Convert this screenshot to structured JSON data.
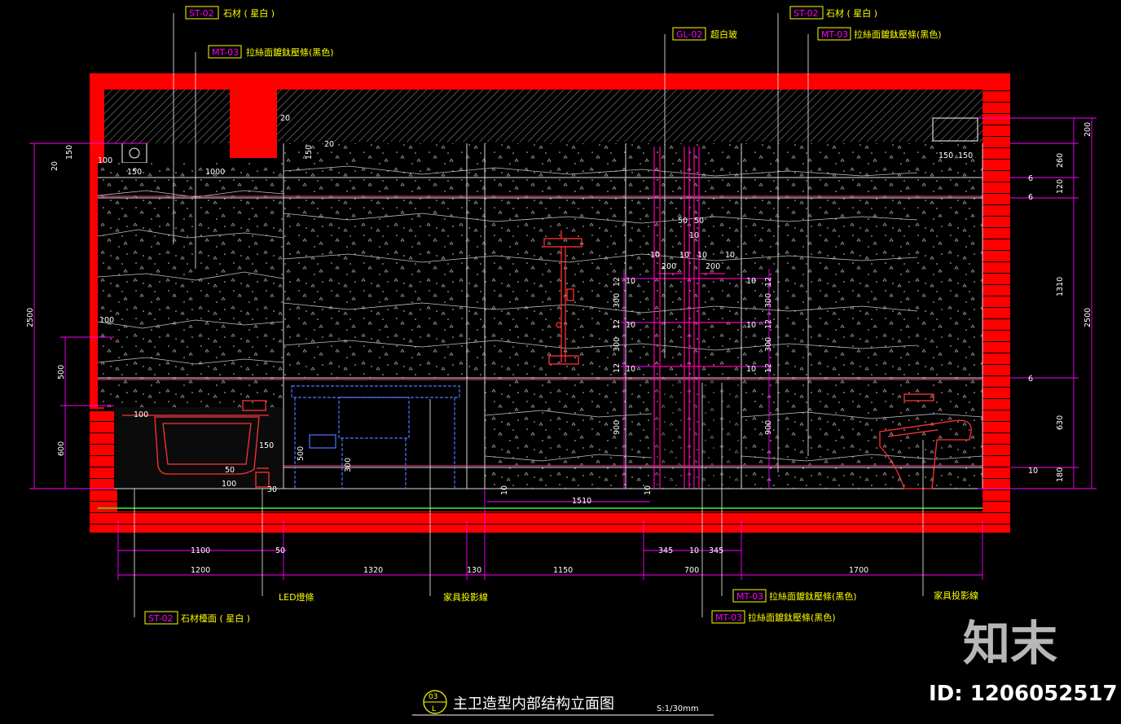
{
  "title": {
    "view_no": "03",
    "sheet_ref": "L",
    "text": "主卫造型内部结构立面图",
    "scale": "S:1/30mm"
  },
  "tags": {
    "top_left_1": {
      "code": "ST-02",
      "text": "石材 ( 星白 )"
    },
    "top_left_2": {
      "code": "MT-03",
      "text": "拉絲面鍍鈦壓條(黑色)"
    },
    "top_mid": {
      "code": "GL-02",
      "text": "超白玻"
    },
    "top_right_1": {
      "code": "ST-02",
      "text": "石材 ( 星白 )"
    },
    "top_right_2": {
      "code": "MT-03",
      "text": "拉絲面鍍鈦壓條(黑色)"
    },
    "bottom_led": {
      "code": "",
      "text": "LED燈條"
    },
    "bottom_furn_1": {
      "code": "",
      "text": "家具投影線"
    },
    "bottom_stone": {
      "code": "ST-02",
      "text": "石材檯面 ( 星白 )"
    },
    "bottom_mt_1": {
      "code": "MT-03",
      "text": "拉絲面鍍鈦壓條(黑色)"
    },
    "bottom_mt_2": {
      "code": "MT-03",
      "text": "拉絲面鍍鈦壓條(黑色)"
    },
    "bottom_furn_2": {
      "code": "",
      "text": "家具投影線"
    }
  },
  "dims": {
    "d_1100": "1100",
    "d_50a": "50",
    "d_1200": "1200",
    "d_1320": "1320",
    "d_130": "130",
    "d_1150": "1150",
    "d_700": "700",
    "d_1700": "1700",
    "d_345a": "345",
    "d_10a": "10",
    "d_345b": "345",
    "d_1510": "1510",
    "d_10b": "10",
    "d_10c": "10",
    "l_2500": "2500",
    "l_500": "500",
    "l_600": "600",
    "l_150": "150",
    "l_20": "20",
    "l_100a": "100",
    "l_150b": "150",
    "l_1000": "1000",
    "l_150c": "150",
    "l_20b": "20",
    "l_20c": "20",
    "l_100b": "100",
    "l_100c": "100",
    "l_150d": "150",
    "l_50": "50",
    "l_30": "30",
    "l_500b": "500",
    "l_300": "300",
    "r_200": "200",
    "r_260": "260",
    "r_120": "120",
    "r_1310": "1310",
    "r_630": "630",
    "r_180": "180",
    "r_2500": "2500",
    "r_6a": "6",
    "r_6b": "6",
    "r_6c": "6",
    "r_10": "10",
    "r_150a": "150",
    "r_150b": "150",
    "s_50a": "50",
    "s_50b": "50",
    "s_10": "10",
    "s_10a": "10",
    "s_200a": "200",
    "s_10b": "10",
    "s_10c": "10",
    "s_200b": "200",
    "s_10d": "10",
    "s_12a": "12",
    "s_300a": "300",
    "s_12b": "12",
    "s_300b": "300",
    "s_12c": "12",
    "s_900a": "900",
    "s_12d": "12",
    "s_300c": "300",
    "s_12e": "12",
    "s_300d": "300",
    "s_12f": "12",
    "s_900b": "900",
    "s_10e": "10",
    "s_10f": "10",
    "s_10g": "10",
    "s_10h": "10",
    "s_10i": "10",
    "s_10j": "10"
  },
  "watermark": {
    "brand": "知末",
    "id": "ID: 1206052517"
  },
  "colors": {
    "frame": "#ff0000",
    "dimension": "#ff00ff",
    "tag_text": "#ffff00",
    "stone": "#ffffff",
    "furniture": "#4a78ff"
  }
}
